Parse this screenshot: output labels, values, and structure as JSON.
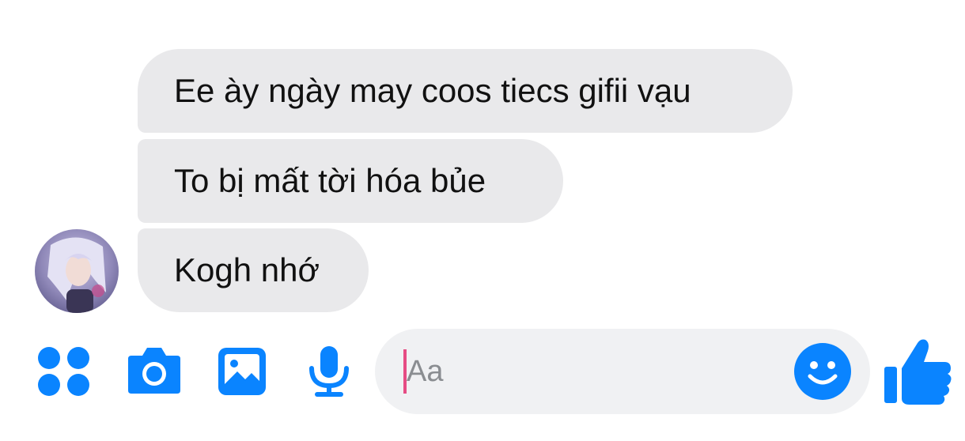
{
  "messages": [
    {
      "text": "Ee ày ngày may coos tiecs gifii vạu"
    },
    {
      "text": "To bị mất tời hóa bủe"
    },
    {
      "text": "Kogh nhớ"
    }
  ],
  "composer": {
    "placeholder": "Aa",
    "icons": [
      "menu-icon",
      "camera-icon",
      "gallery-icon",
      "microphone-icon",
      "emoji-icon",
      "like-icon"
    ]
  },
  "colors": {
    "bubble": "#e9e9eb",
    "accent": "#0a84ff",
    "input_background": "#f0f1f3",
    "caret": "#e64c84"
  }
}
